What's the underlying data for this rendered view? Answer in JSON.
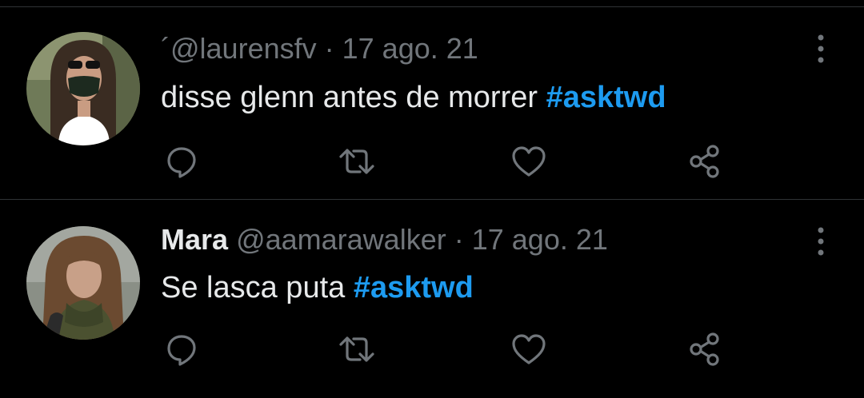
{
  "colors": {
    "background": "#000000",
    "text": "#e7e9ea",
    "muted": "#71767b",
    "hashtag": "#1d9bf0",
    "divider": "#2f3336"
  },
  "tweets": [
    {
      "display_name": "",
      "handle": "´@laurensfv",
      "separator": "·",
      "date": "17 ago. 21",
      "text": "disse glenn antes de morrer",
      "hashtag": "#asktwd",
      "avatar_icon": "avatar-photo",
      "actions": [
        "reply-icon",
        "retweet-icon",
        "like-icon",
        "share-icon"
      ]
    },
    {
      "display_name": "Mara",
      "handle": "@aamarawalker",
      "separator": "·",
      "date": "17 ago. 21",
      "text": "Se lasca puta",
      "hashtag": "#asktwd",
      "avatar_icon": "avatar-photo",
      "actions": [
        "reply-icon",
        "retweet-icon",
        "like-icon",
        "share-icon"
      ]
    }
  ]
}
